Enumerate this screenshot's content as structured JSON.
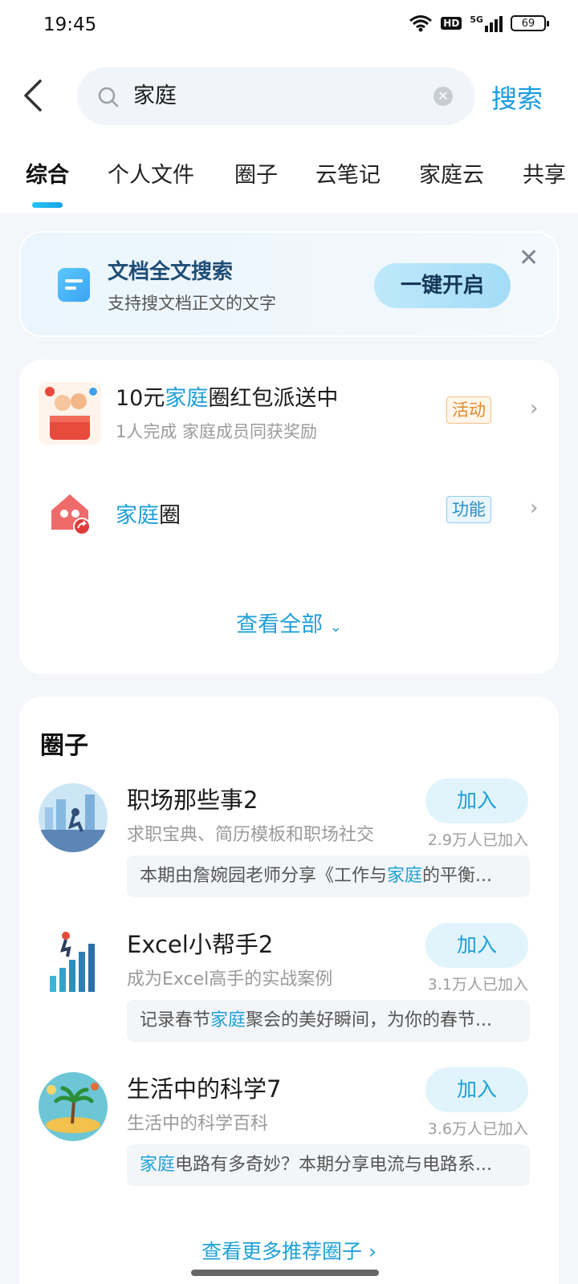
{
  "status_bar": {
    "time": "19:45",
    "network": "5G",
    "hd": "HD",
    "battery": "69"
  },
  "header": {
    "query": "家庭",
    "search_label": "搜索"
  },
  "tabs": [
    {
      "label": "综合",
      "active": true
    },
    {
      "label": "个人文件"
    },
    {
      "label": "圈子"
    },
    {
      "label": "云笔记"
    },
    {
      "label": "家庭云"
    },
    {
      "label": "共享"
    }
  ],
  "promo": {
    "title": "文档全文搜索",
    "subtitle": "支持搜文档正文的文字",
    "button": "一键开启"
  },
  "features": {
    "items": [
      {
        "title_prefix": "10元",
        "title_highlight": "家庭",
        "title_suffix": "圈红包派送中",
        "subtitle": "1人完成 家庭成员同获奖励",
        "tag": "活动"
      },
      {
        "title_prefix": "",
        "title_highlight": "家庭",
        "title_suffix": "圈",
        "subtitle": "",
        "tag": "功能"
      }
    ],
    "see_all": "查看全部"
  },
  "circles": {
    "heading": "圈子",
    "join_label": "加入",
    "items": [
      {
        "name": "职场那些事2",
        "desc": "求职宝典、简历模板和职场社交",
        "count": "2.9万人已加入",
        "post_prefix": "本期由詹婉园老师分享《工作与",
        "post_highlight": "家庭",
        "post_suffix": "的平衡..."
      },
      {
        "name": "Excel小帮手2",
        "desc": "成为Excel高手的实战案例",
        "count": "3.1万人已加入",
        "post_prefix": "记录春节",
        "post_highlight": "家庭",
        "post_suffix": "聚会的美好瞬间，为你的春节..."
      },
      {
        "name": "生活中的科学7",
        "desc": "生活中的科学百科",
        "count": "3.6万人已加入",
        "post_prefix": "",
        "post_highlight": "家庭",
        "post_suffix": "电路有多奇妙？本期分享电流与电路系..."
      }
    ],
    "more": "查看更多推荐圈子 ›"
  },
  "colors": {
    "accent": "#1ea0d8",
    "brand_blue": "#1a9be0",
    "tag_orange": "#e08a2a"
  }
}
